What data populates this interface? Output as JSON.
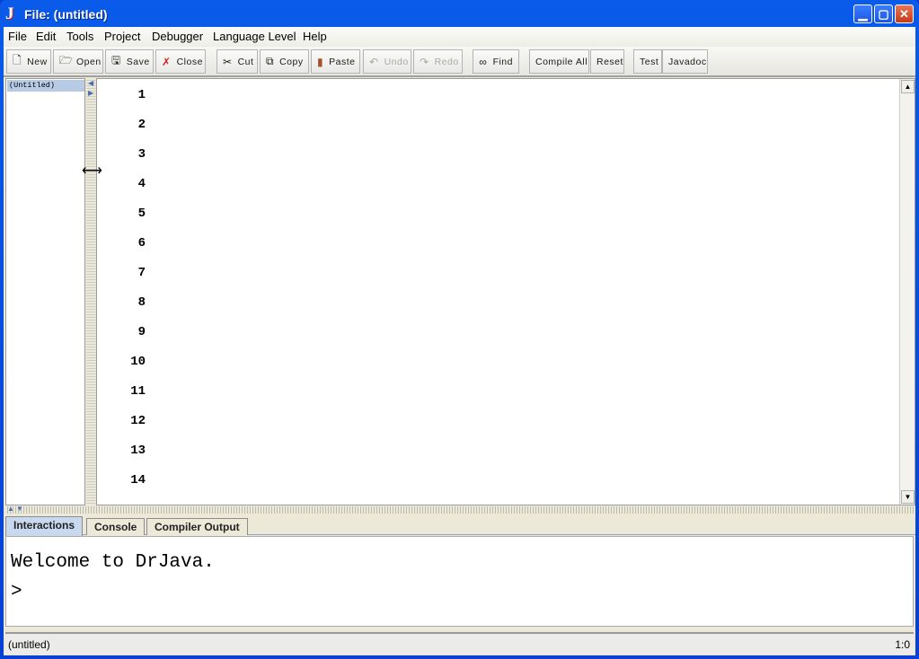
{
  "window": {
    "title": "File: (untitled)",
    "app_icon": "drjava-j-icon"
  },
  "menubar": [
    "File",
    "Edit",
    "Tools",
    "Project",
    "Debugger",
    "Language Level",
    "Help"
  ],
  "toolbar": [
    {
      "label": "New",
      "icon": "new-file-icon",
      "enabled": true
    },
    {
      "label": "Open",
      "icon": "open-folder-icon",
      "enabled": true
    },
    {
      "label": "Save",
      "icon": "floppy-icon",
      "enabled": true
    },
    {
      "label": "Close",
      "icon": "close-file-icon",
      "enabled": true
    },
    {
      "label": "Cut",
      "icon": "scissors-icon",
      "enabled": true
    },
    {
      "label": "Copy",
      "icon": "copy-icon",
      "enabled": true
    },
    {
      "label": "Paste",
      "icon": "clipboard-icon",
      "enabled": true
    },
    {
      "label": "Undo",
      "icon": "undo-icon",
      "enabled": false
    },
    {
      "label": "Redo",
      "icon": "redo-icon",
      "enabled": false
    },
    {
      "label": "Find",
      "icon": "binoculars-icon",
      "enabled": true
    },
    {
      "label": "Compile All",
      "enabled": true
    },
    {
      "label": "Reset",
      "enabled": true
    },
    {
      "label": "Test",
      "enabled": true
    },
    {
      "label": "Javadoc",
      "enabled": true
    }
  ],
  "documents": [
    "(Untitled)"
  ],
  "editor": {
    "line_numbers": [
      "1",
      "2",
      "3",
      "4",
      "5",
      "6",
      "7",
      "8",
      "9",
      "10",
      "11",
      "12",
      "13",
      "14"
    ]
  },
  "tabs": {
    "active": "Interactions",
    "items": [
      "Interactions",
      "Console",
      "Compiler Output"
    ]
  },
  "interactions": {
    "welcome": "Welcome to DrJava.",
    "prompt": ">"
  },
  "status": {
    "file": "(untitled)",
    "position": "1:0"
  }
}
